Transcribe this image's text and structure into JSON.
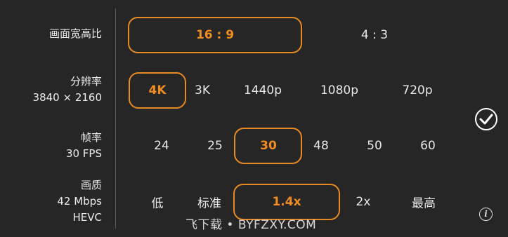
{
  "accent_color": "#f08c20",
  "rows": [
    {
      "title": "画面宽高比",
      "subtitle_lines": [],
      "selected": "16 : 9",
      "options": [
        "16 : 9",
        "4 : 3"
      ]
    },
    {
      "title": "分辨率",
      "subtitle_lines": [
        "3840 × 2160"
      ],
      "selected": "4K",
      "options": [
        "4K",
        "3K",
        "1440p",
        "1080p",
        "720p"
      ]
    },
    {
      "title": "帧率",
      "subtitle_lines": [
        "30 FPS"
      ],
      "selected": "30",
      "options": [
        "24",
        "25",
        "30",
        "48",
        "50",
        "60"
      ]
    },
    {
      "title": "画质",
      "subtitle_lines": [
        "42 Mbps",
        "HEVC"
      ],
      "selected": "1.4x",
      "options": [
        "低",
        "标准",
        "1.4x",
        "2x",
        "最高"
      ]
    }
  ],
  "confirm_icon": "check-circle-icon",
  "info_icon": "info-icon",
  "info_glyph": "i",
  "watermark": "飞下载 • BYFZXY.COM"
}
